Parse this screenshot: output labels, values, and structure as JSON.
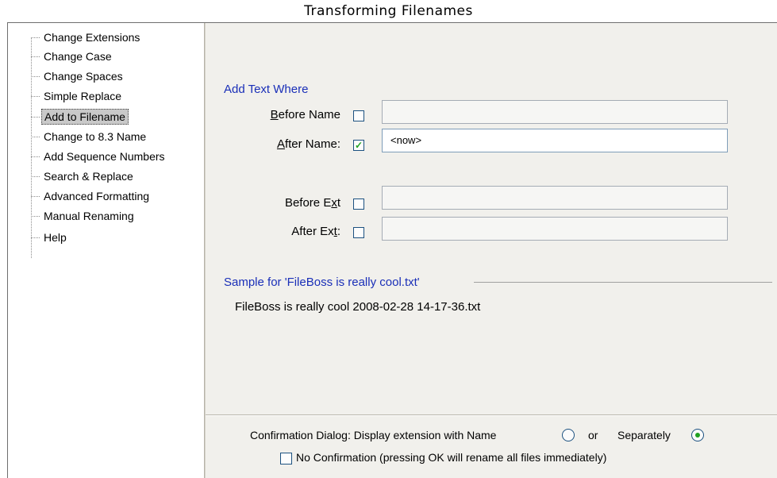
{
  "window": {
    "title": "Transforming Filenames"
  },
  "tree": {
    "items": [
      {
        "label": "Change Extensions"
      },
      {
        "label": "Change Case"
      },
      {
        "label": "Change Spaces"
      },
      {
        "label": "Simple Replace"
      },
      {
        "label": "Add to Filename",
        "selected": true
      },
      {
        "label": "Change to 8.3 Name"
      },
      {
        "label": "Add Sequence Numbers"
      },
      {
        "label": "Search & Replace"
      },
      {
        "label": "Advanced Formatting"
      },
      {
        "label": "Manual Renaming"
      },
      {
        "label": "Help"
      }
    ]
  },
  "add_text": {
    "section_title": "Add Text Where",
    "before_name": {
      "label_prefix": "",
      "label_mnemonic": "B",
      "label_rest": "efore Name",
      "checked": false,
      "value": ""
    },
    "after_name": {
      "label_prefix": "",
      "label_mnemonic": "A",
      "label_rest": "fter Name:",
      "checked": true,
      "value": "<now>"
    },
    "before_ext": {
      "label_prefix": "Before E",
      "label_mnemonic": "x",
      "label_rest": "t",
      "checked": false,
      "value": ""
    },
    "after_ext": {
      "label_prefix": "After Ex",
      "label_mnemonic": "t",
      "label_rest": ":",
      "checked": false,
      "value": ""
    }
  },
  "sample": {
    "title": "Sample for 'FileBoss is really cool.txt'",
    "value": "FileBoss is really cool 2008-02-28 14-17-36.txt"
  },
  "confirmation": {
    "label": "Confirmation Dialog: Display extension with Name",
    "or_label": "or",
    "separately_label": "Separately",
    "selected": "separately",
    "no_confirmation_label": "No Confirmation (pressing OK will rename all files immediately)",
    "no_confirmation_checked": false
  },
  "colors": {
    "accent_text": "#1a2fb8",
    "check": "#21a121",
    "panel_bg": "#f1f0ec"
  },
  "icons": {
    "check": "checkmark-icon",
    "radio_dot": "radio-dot-icon"
  }
}
